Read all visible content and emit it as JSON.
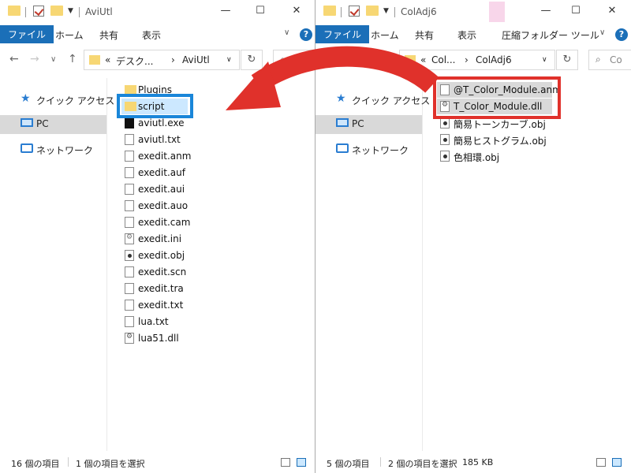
{
  "colors": {
    "accent": "#1b6fb8",
    "arrow": "#e0312b",
    "highlight_blue": "#1a86d9",
    "highlight_red": "#e0312b"
  },
  "left_window": {
    "title": "AviUtl",
    "ribbon": {
      "file": "ファイル",
      "tabs": [
        "ホーム",
        "共有",
        "表示"
      ]
    },
    "address": {
      "prefix": "«",
      "crumbs": [
        "デスク...",
        "AviUtl"
      ],
      "separator": "›"
    },
    "search_placeholder": "P",
    "nav": [
      "クイック アクセス",
      "PC",
      "ネットワーク"
    ],
    "files": [
      {
        "name": "Plugins",
        "icon": "folder-icon"
      },
      {
        "name": "script",
        "icon": "folder-icon"
      },
      {
        "name": "aviutl.exe",
        "icon": "exe-icon"
      },
      {
        "name": "aviutl.txt",
        "icon": "txt-icon"
      },
      {
        "name": "exedit.anm",
        "icon": "file-icon"
      },
      {
        "name": "exedit.auf",
        "icon": "file-icon"
      },
      {
        "name": "exedit.aui",
        "icon": "file-icon"
      },
      {
        "name": "exedit.auo",
        "icon": "file-icon"
      },
      {
        "name": "exedit.cam",
        "icon": "file-icon"
      },
      {
        "name": "exedit.ini",
        "icon": "ini-icon"
      },
      {
        "name": "exedit.obj",
        "icon": "obj-icon"
      },
      {
        "name": "exedit.scn",
        "icon": "file-icon"
      },
      {
        "name": "exedit.tra",
        "icon": "file-icon"
      },
      {
        "name": "exedit.txt",
        "icon": "txt-icon"
      },
      {
        "name": "lua.txt",
        "icon": "txt-icon"
      },
      {
        "name": "lua51.dll",
        "icon": "dll-icon"
      }
    ],
    "status": {
      "count": "16 個の項目",
      "selected": "1 個の項目を選択"
    }
  },
  "right_window": {
    "title": "ColAdj6",
    "ribbon": {
      "file": "ファイル",
      "tabs": [
        "ホーム",
        "共有",
        "表示"
      ],
      "context_tab": "圧縮フォルダー ツール"
    },
    "address": {
      "prefix": "«",
      "crumbs": [
        "Col...",
        "ColAdj6"
      ],
      "separator": "›"
    },
    "search_placeholder": "Co",
    "nav": [
      "クイック アクセス",
      "PC",
      "ネットワーク"
    ],
    "files": [
      {
        "name": "@T_Color_Module.anm",
        "icon": "file-icon"
      },
      {
        "name": "T_Color_Module.dll",
        "icon": "dll-icon"
      },
      {
        "name": "簡易トーンカーブ.obj",
        "icon": "obj-icon"
      },
      {
        "name": "簡易ヒストグラム.obj",
        "icon": "obj-icon"
      },
      {
        "name": "色相環.obj",
        "icon": "obj-icon"
      }
    ],
    "status": {
      "count": "5 個の項目",
      "selected": "2 個の項目を選択",
      "size": "185 KB"
    }
  }
}
